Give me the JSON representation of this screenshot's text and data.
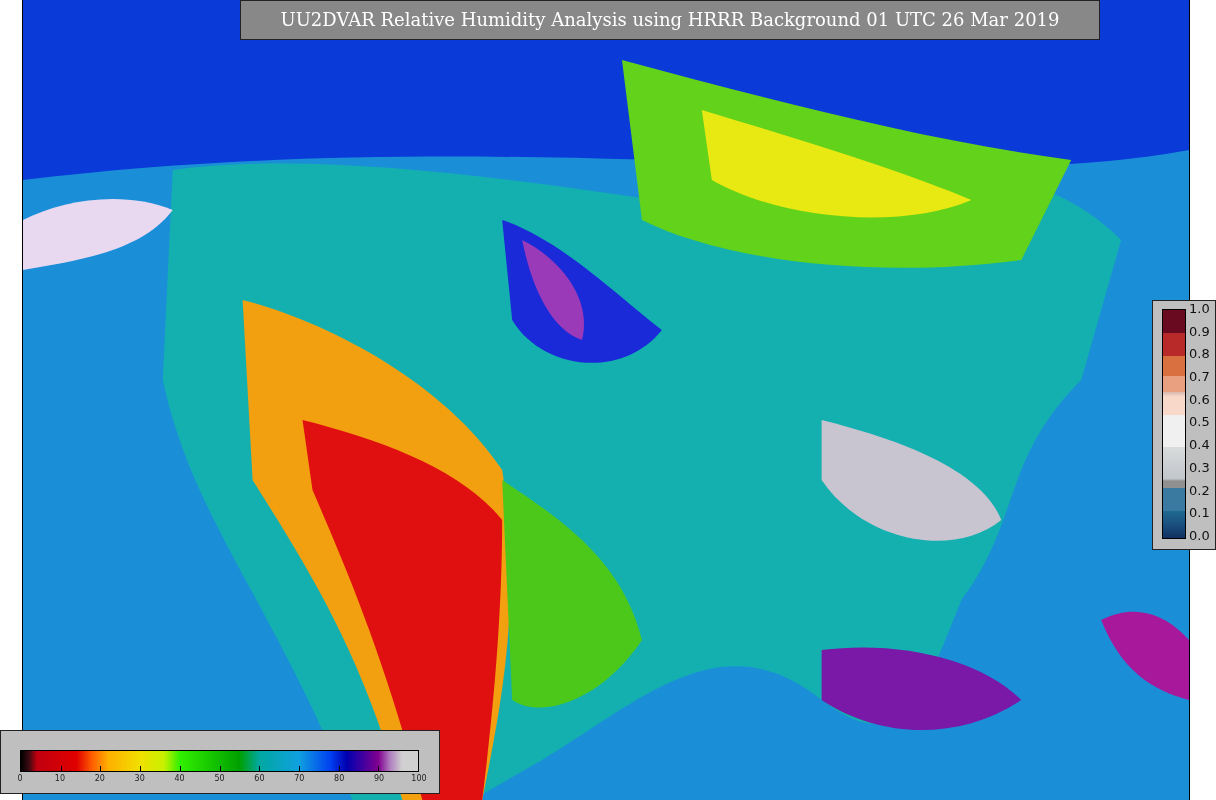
{
  "title": "UU2DVAR Relative Humidity Analysis using HRRR Background 01 UTC 26 Mar 2019",
  "humidity_colorbar": {
    "ticks": [
      "0",
      "10",
      "20",
      "30",
      "40",
      "50",
      "60",
      "70",
      "80",
      "90",
      "100"
    ]
  },
  "ratio_colorbar": {
    "ticks": [
      "1.0",
      "0.9",
      "0.8",
      "0.7",
      "0.6",
      "0.5",
      "0.4",
      "0.3",
      "0.2",
      "0.1",
      "0.0"
    ]
  }
}
